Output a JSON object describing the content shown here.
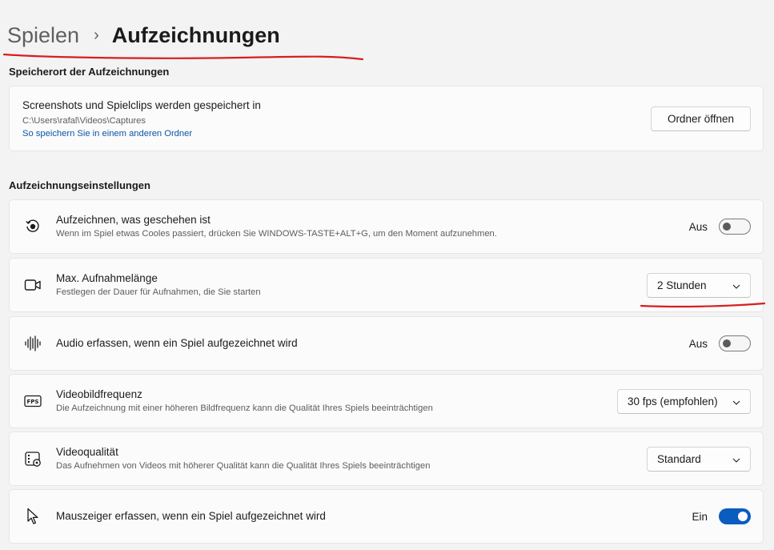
{
  "breadcrumb": {
    "parent": "Spielen",
    "separator": "›",
    "current": "Aufzeichnungen"
  },
  "storage": {
    "section_title": "Speicherort der Aufzeichnungen",
    "title": "Screenshots und Spielclips werden gespeichert in",
    "path": "C:\\Users\\rafal\\Videos\\Captures",
    "link": "So speichern Sie in einem anderen Ordner",
    "open_button": "Ordner öffnen"
  },
  "settings": {
    "section_title": "Aufzeichnungseinstellungen",
    "record_what_happened": {
      "title": "Aufzeichnen, was geschehen ist",
      "desc": "Wenn im Spiel etwas Cooles passiert, drücken Sie WINDOWS-TASTE+ALT+G, um den Moment aufzunehmen.",
      "state_label": "Aus",
      "state": false,
      "icon": "record-history-icon"
    },
    "max_length": {
      "title": "Max. Aufnahmelänge",
      "desc": "Festlegen der Dauer für Aufnahmen, die Sie starten",
      "value": "2 Stunden",
      "icon": "video-camera-icon"
    },
    "audio": {
      "title": "Audio erfassen, wenn ein Spiel aufgezeichnet wird",
      "state_label": "Aus",
      "state": false,
      "icon": "audio-wave-icon"
    },
    "framerate": {
      "title": "Videobildfrequenz",
      "desc": "Die Aufzeichnung mit einer höheren Bildfrequenz kann die Qualität Ihres Spiels beeinträchtigen",
      "value": "30 fps (empfohlen)",
      "icon": "fps-icon",
      "icon_text": "FPS"
    },
    "quality": {
      "title": "Videoqualität",
      "desc": "Das Aufnehmen von Videos mit höherer Qualität kann die Qualität Ihres Spiels beeinträchtigen",
      "value": "Standard",
      "icon": "video-quality-icon"
    },
    "mouse_cursor": {
      "title": "Mauszeiger erfassen, wenn ein Spiel aufgezeichnet wird",
      "state_label": "Ein",
      "state": true,
      "icon": "mouse-pointer-icon"
    }
  },
  "colors": {
    "accent": "#0a5cbf",
    "link": "#0b56a8",
    "annotation": "#d81e1e"
  }
}
